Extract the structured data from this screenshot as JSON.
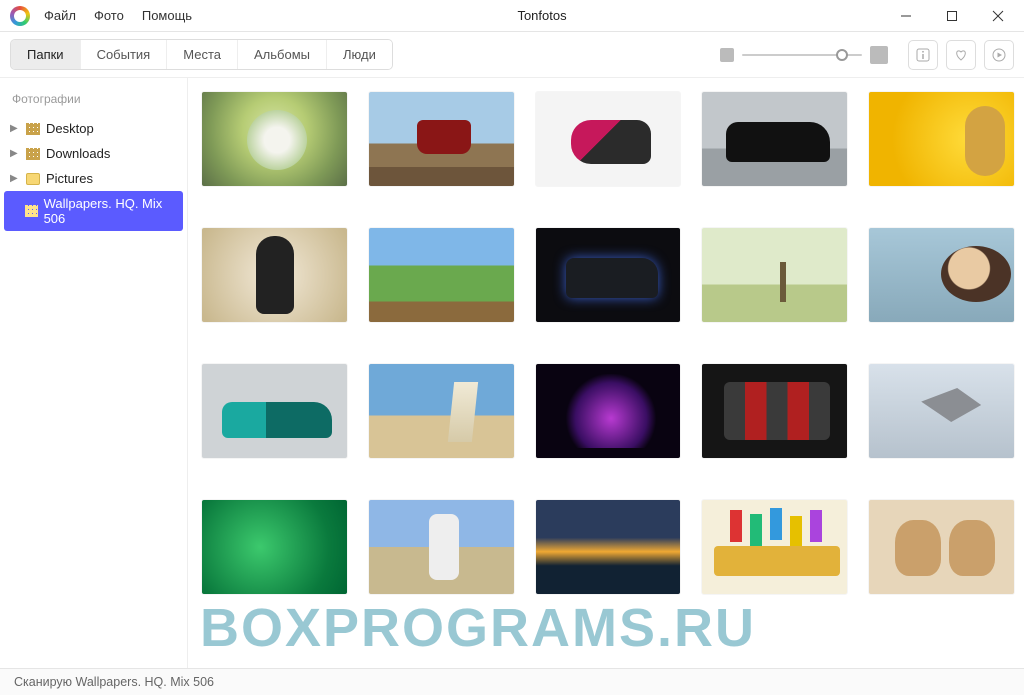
{
  "app": {
    "title": "Tonfotos"
  },
  "menu": {
    "file": "Файл",
    "photo": "Фото",
    "help": "Помощь"
  },
  "tabs": {
    "folders": "Папки",
    "events": "События",
    "places": "Места",
    "albums": "Альбомы",
    "people": "Люди",
    "active": "folders"
  },
  "sidebar": {
    "header": "Фотографии",
    "items": [
      {
        "label": "Desktop",
        "type": "grid",
        "expandable": true
      },
      {
        "label": "Downloads",
        "type": "grid",
        "expandable": true
      },
      {
        "label": "Pictures",
        "type": "folder",
        "expandable": true
      },
      {
        "label": "Wallpapers. HQ. Mix 506",
        "type": "grid",
        "expandable": false,
        "selected": true
      }
    ]
  },
  "thumbnails": {
    "count": 20
  },
  "status": {
    "text": "Сканирую Wallpapers. HQ. Mix 506"
  },
  "watermark": "BOXPROGRAMS.RU"
}
